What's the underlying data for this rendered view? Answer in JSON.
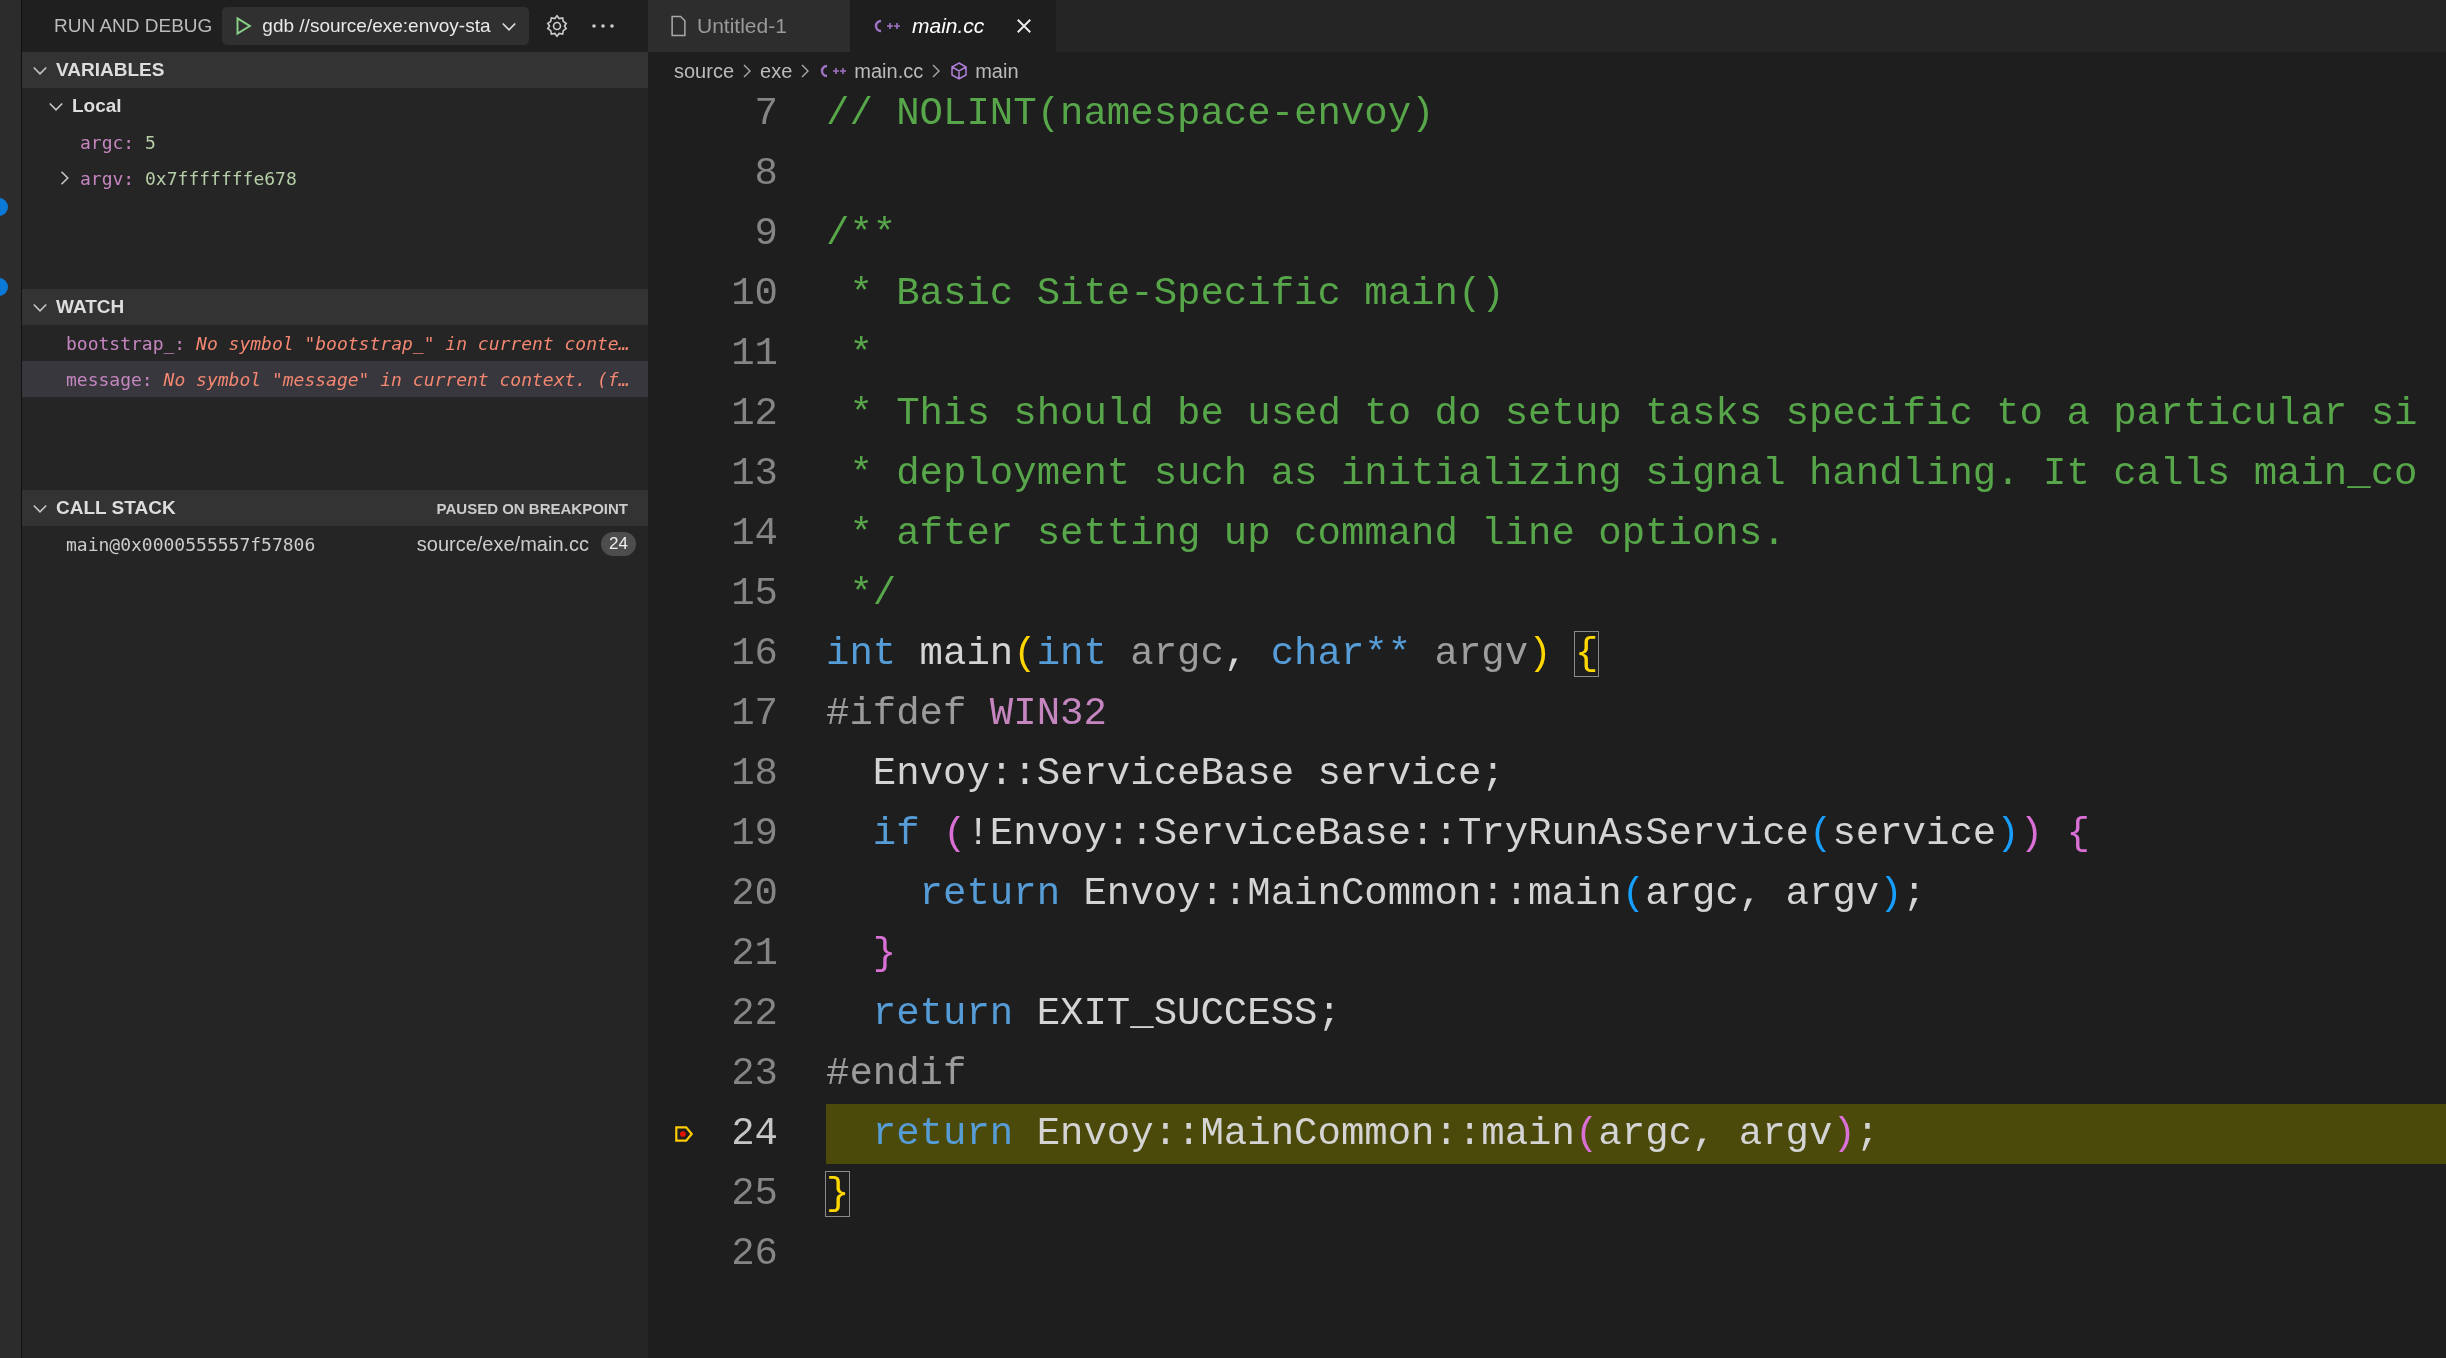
{
  "debug_bar": {
    "title": "RUN AND DEBUG",
    "configuration": "gdb //source/exe:envoy-sta"
  },
  "variables": {
    "title": "VARIABLES",
    "expanded": true,
    "scopes": [
      {
        "label": "Local",
        "expanded": true,
        "children": [
          {
            "name": "argc:",
            "value": "5",
            "expandable": false
          },
          {
            "name": "argv:",
            "value": "0x7fffffffe678",
            "expandable": true,
            "expanded": false
          }
        ]
      }
    ]
  },
  "watch": {
    "title": "WATCH",
    "expanded": true,
    "items": [
      {
        "name": "bootstrap_:",
        "message": "No symbol \"bootstrap_\" in current conte…",
        "selected": false
      },
      {
        "name": "message:",
        "message": "No symbol \"message\" in current context. (f…",
        "selected": true
      }
    ]
  },
  "call_stack": {
    "title": "CALL STACK",
    "expanded": true,
    "status": "PAUSED ON BREAKPOINT",
    "frames": [
      {
        "name": "main@0x0000555557f57806",
        "file": "source/exe/main.cc",
        "line": "24"
      }
    ]
  },
  "tabs": [
    {
      "label": "Untitled-1",
      "kind": "file",
      "selected": false
    },
    {
      "label": "main.cc",
      "kind": "cpp",
      "selected": true
    }
  ],
  "breadcrumbs": [
    {
      "label": "source",
      "kind": "folder"
    },
    {
      "label": "exe",
      "kind": "folder"
    },
    {
      "label": "main.cc",
      "kind": "cpp"
    },
    {
      "label": "main",
      "kind": "symbol"
    }
  ],
  "editor": {
    "lines": [
      {
        "number": "7",
        "current": false,
        "tokens": [
          {
            "kind": "comment",
            "text": "// NOLINT(namespace-envoy)"
          }
        ]
      },
      {
        "number": "8",
        "current": false
      },
      {
        "number": "9",
        "current": false,
        "tokens": [
          {
            "kind": "comment",
            "text": "/**"
          }
        ]
      },
      {
        "number": "10",
        "current": false,
        "tokens": [
          {
            "kind": "comment",
            "text": " * Basic Site-Specific main()"
          }
        ]
      },
      {
        "number": "11",
        "current": false,
        "tokens": [
          {
            "kind": "comment",
            "text": " *"
          }
        ]
      },
      {
        "number": "12",
        "current": false,
        "tokens": [
          {
            "kind": "comment",
            "text": " * This should be used to do setup tasks specific to a particular si"
          }
        ]
      },
      {
        "number": "13",
        "current": false,
        "tokens": [
          {
            "kind": "comment",
            "text": " * deployment such as initializing signal handling. It calls main_co"
          }
        ]
      },
      {
        "number": "14",
        "current": false,
        "tokens": [
          {
            "kind": "comment",
            "text": " * after setting up command line options."
          }
        ]
      },
      {
        "number": "15",
        "current": false,
        "tokens": [
          {
            "kind": "comment",
            "text": " */"
          }
        ]
      },
      {
        "number": "16",
        "current": false,
        "tokens": [
          {
            "kind": "keyword",
            "text": "int"
          },
          {
            "kind": "text",
            "text": " main"
          },
          {
            "kind": "paren-yellow",
            "text": "("
          },
          {
            "kind": "keyword",
            "text": "int"
          },
          {
            "kind": "param",
            "text": " argc"
          },
          {
            "kind": "text",
            "text": ", "
          },
          {
            "kind": "keyword",
            "text": "char**"
          },
          {
            "kind": "param",
            "text": " argv"
          },
          {
            "kind": "paren-yellow",
            "text": ") "
          },
          {
            "kind": "brace-match",
            "text": "{"
          }
        ]
      },
      {
        "number": "17",
        "current": false,
        "tokens": [
          {
            "kind": "preproc",
            "text": "#ifdef "
          },
          {
            "kind": "macro",
            "text": "WIN32"
          }
        ]
      },
      {
        "number": "18",
        "current": false,
        "tokens": [
          {
            "kind": "text",
            "text": "  Envoy::ServiceBase service;"
          }
        ]
      },
      {
        "number": "19",
        "current": false,
        "tokens": [
          {
            "kind": "keyword",
            "text": "  if "
          },
          {
            "kind": "paren-pink",
            "text": "("
          },
          {
            "kind": "text",
            "text": "!Envoy::ServiceBase::TryRunAsService"
          },
          {
            "kind": "paren-blue",
            "text": "("
          },
          {
            "kind": "text",
            "text": "service"
          },
          {
            "kind": "paren-blue",
            "text": ")"
          },
          {
            "kind": "paren-pink",
            "text": ") "
          },
          {
            "kind": "paren-pink",
            "text": "{"
          }
        ]
      },
      {
        "number": "20",
        "current": false,
        "tokens": [
          {
            "kind": "keyword",
            "text": "    return"
          },
          {
            "kind": "text",
            "text": " Envoy::MainCommon::main"
          },
          {
            "kind": "paren-blue",
            "text": "("
          },
          {
            "kind": "text",
            "text": "argc, argv"
          },
          {
            "kind": "paren-blue",
            "text": ")"
          },
          {
            "kind": "text",
            "text": ";"
          }
        ]
      },
      {
        "number": "21",
        "current": false,
        "tokens": [
          {
            "kind": "paren-pink",
            "text": "  }"
          }
        ]
      },
      {
        "number": "22",
        "current": false,
        "tokens": [
          {
            "kind": "keyword",
            "text": "  return"
          },
          {
            "kind": "text",
            "text": " EXIT_SUCCESS;"
          }
        ]
      },
      {
        "number": "23",
        "current": false,
        "tokens": [
          {
            "kind": "preproc",
            "text": "#endif"
          }
        ]
      },
      {
        "number": "24",
        "current": true,
        "tokens": [
          {
            "kind": "keyword",
            "text": "  return"
          },
          {
            "kind": "text",
            "text": " Envoy::MainCommon::main"
          },
          {
            "kind": "paren-pink",
            "text": "("
          },
          {
            "kind": "text",
            "text": "argc, argv"
          },
          {
            "kind": "paren-pink",
            "text": ")"
          },
          {
            "kind": "text",
            "text": ";"
          }
        ]
      },
      {
        "number": "25",
        "current": false,
        "tokens": [
          {
            "kind": "brace-match",
            "text": "}"
          }
        ]
      },
      {
        "number": "26",
        "current": false
      }
    ]
  }
}
